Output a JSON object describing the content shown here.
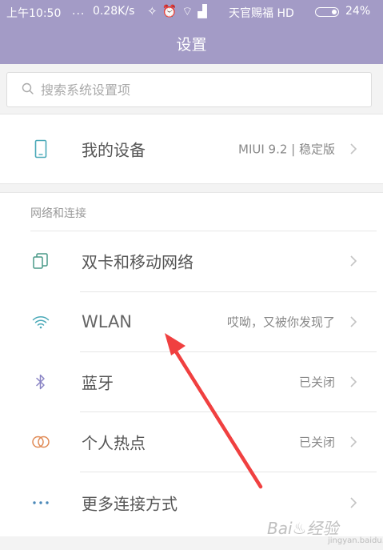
{
  "status_bar": {
    "time": "上午10:50",
    "dots": "...",
    "speed": "0.28K/s",
    "carrier": "天官赐福 HD",
    "battery": "24%"
  },
  "title": "设置",
  "search": {
    "placeholder": "搜索系统设置项"
  },
  "device": {
    "label": "我的设备",
    "value": "MIUI 9.2 | 稳定版"
  },
  "network_section": {
    "header": "网络和连接",
    "items": [
      {
        "label": "双卡和移动网络",
        "value": ""
      },
      {
        "label": "WLAN",
        "value": "哎呦，又被你发现了"
      },
      {
        "label": "蓝牙",
        "value": "已关闭"
      },
      {
        "label": "个人热点",
        "value": "已关闭"
      },
      {
        "label": "更多连接方式",
        "value": ""
      }
    ]
  },
  "watermark": {
    "text": "Bai♨经验",
    "sub": "jingyan.baidu.com"
  },
  "colors": {
    "header": "#a39bc6",
    "annotation_arrow": "#f04040"
  }
}
